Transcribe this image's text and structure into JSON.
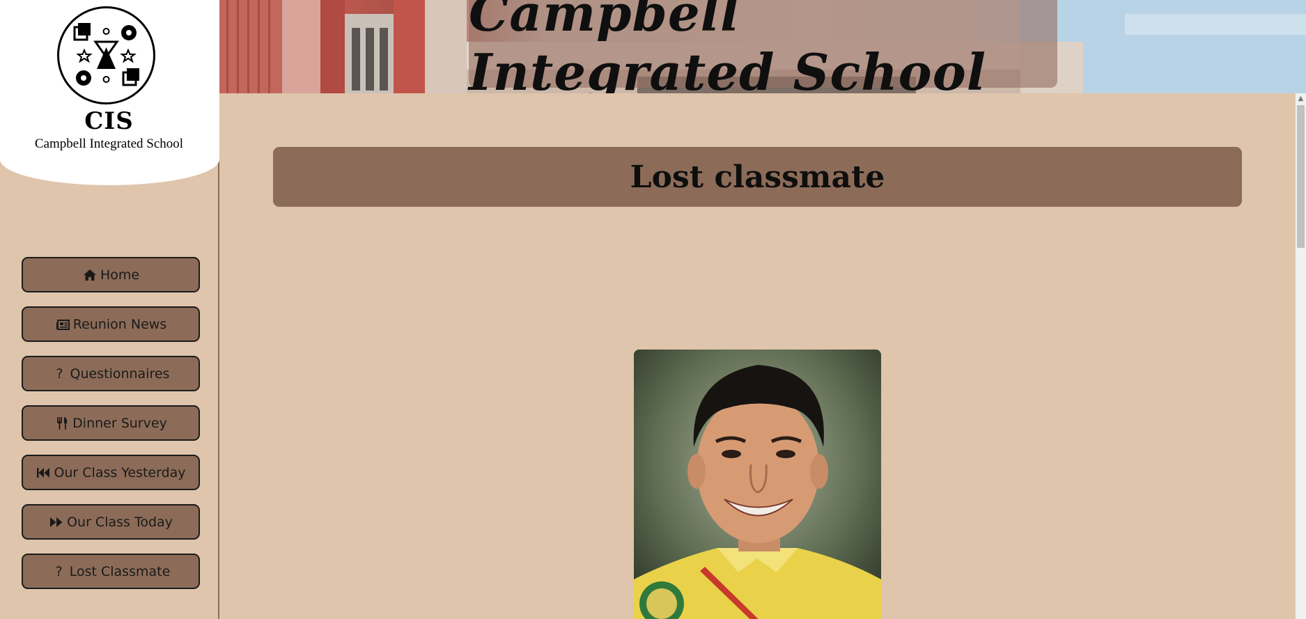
{
  "logo": {
    "abbr": "CIS",
    "name": "Campbell Integrated School"
  },
  "banner": {
    "title": "Campbell Integrated School"
  },
  "nav": {
    "items": [
      {
        "label": "Home",
        "icon": "home-icon"
      },
      {
        "label": "Reunion News",
        "icon": "newspaper-icon"
      },
      {
        "label": "Questionnaires",
        "icon": "question-icon"
      },
      {
        "label": "Dinner Survey",
        "icon": "utensils-icon"
      },
      {
        "label": "Our Class Yesterday",
        "icon": "backward-icon"
      },
      {
        "label": "Our Class Today",
        "icon": "forward-icon"
      },
      {
        "label": "Lost Classmate",
        "icon": "question-icon"
      }
    ]
  },
  "main": {
    "section_title": "Lost classmate"
  },
  "colors": {
    "page_bg": "#dfc5ac",
    "button_bg": "#8c6c58",
    "title_bar_bg": "#8c6c58"
  }
}
